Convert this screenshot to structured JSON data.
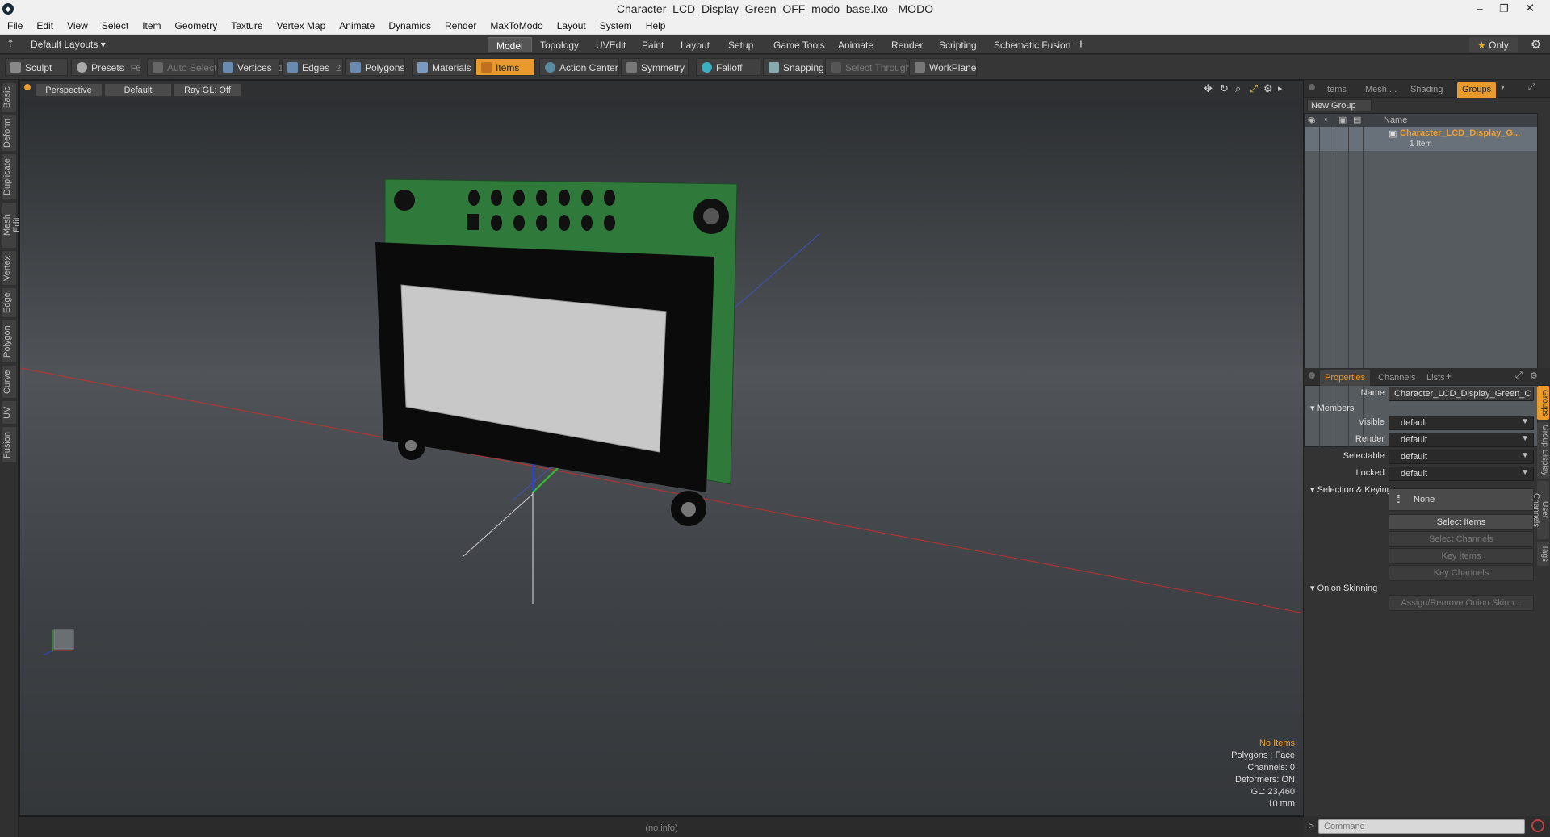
{
  "window": {
    "title": "Character_LCD_Display_Green_OFF_modo_base.lxo - MODO"
  },
  "menu": [
    "File",
    "Edit",
    "View",
    "Select",
    "Item",
    "Geometry",
    "Texture",
    "Vertex Map",
    "Animate",
    "Dynamics",
    "Render",
    "MaxToModo",
    "Layout",
    "System",
    "Help"
  ],
  "layoutbar": {
    "layouts_label": "Default Layouts",
    "tabs": [
      "Model",
      "Topology",
      "UVEdit",
      "Paint",
      "Layout",
      "Setup",
      "Game Tools",
      "Animate",
      "Render",
      "Scripting",
      "Schematic Fusion"
    ],
    "active_tab": "Model",
    "only_label": "Only"
  },
  "toolbar": {
    "sculpt": "Sculpt",
    "presets": "Presets",
    "presets_key": "F6",
    "auto_select": "Auto Select",
    "vertices": "Vertices",
    "vertices_num": "1",
    "edges": "Edges",
    "edges_num": "2",
    "polygons": "Polygons",
    "materials": "Materials",
    "items": "Items",
    "action_center": "Action Center",
    "symmetry": "Symmetry",
    "falloff": "Falloff",
    "snapping": "Snapping",
    "select_through": "Select Through",
    "workplane": "WorkPlane"
  },
  "left_tabs": [
    "Basic",
    "Deform",
    "Duplicate",
    "Mesh Edit",
    "Vertex",
    "Edge",
    "Polygon",
    "Curve",
    "UV",
    "Fusion"
  ],
  "viewport": {
    "view_mode": "Perspective",
    "shading": "Default",
    "raygl": "Ray GL: Off",
    "stats": {
      "no_items": "No Items",
      "polygons": "Polygons : Face",
      "channels": "Channels: 0",
      "deformers": "Deformers: ON",
      "gl": "GL: 23,460",
      "scale": "10 mm"
    },
    "status": "(no info)"
  },
  "groups_panel": {
    "tabs": [
      "Items",
      "Mesh ...",
      "Shading",
      "Groups"
    ],
    "active_tab": "Groups",
    "new_group": "New Group",
    "col_name": "Name",
    "group_name": "Character_LCD_Display_G...",
    "group_count": "1 Item"
  },
  "properties_panel": {
    "tabs": [
      "Properties",
      "Channels",
      "Lists"
    ],
    "name_label": "Name",
    "name_value": "Character_LCD_Display_Green_C",
    "members_section": "Members",
    "rows": [
      {
        "label": "Visible",
        "value": "default"
      },
      {
        "label": "Render",
        "value": "default"
      },
      {
        "label": "Selectable",
        "value": "default"
      },
      {
        "label": "Locked",
        "value": "default"
      }
    ],
    "selection_section": "Selection & Keying",
    "none_label": "None",
    "select_items": "Select Items",
    "select_channels": "Select Channels",
    "key_items": "Key Items",
    "key_channels": "Key Channels",
    "onion_section": "Onion Skinning",
    "assign_onion": "Assign/Remove Onion Skinn...",
    "side_tabs": [
      "Groups",
      "Group Display",
      "User Channels",
      "Tags"
    ]
  },
  "command": {
    "placeholder": "Command"
  }
}
